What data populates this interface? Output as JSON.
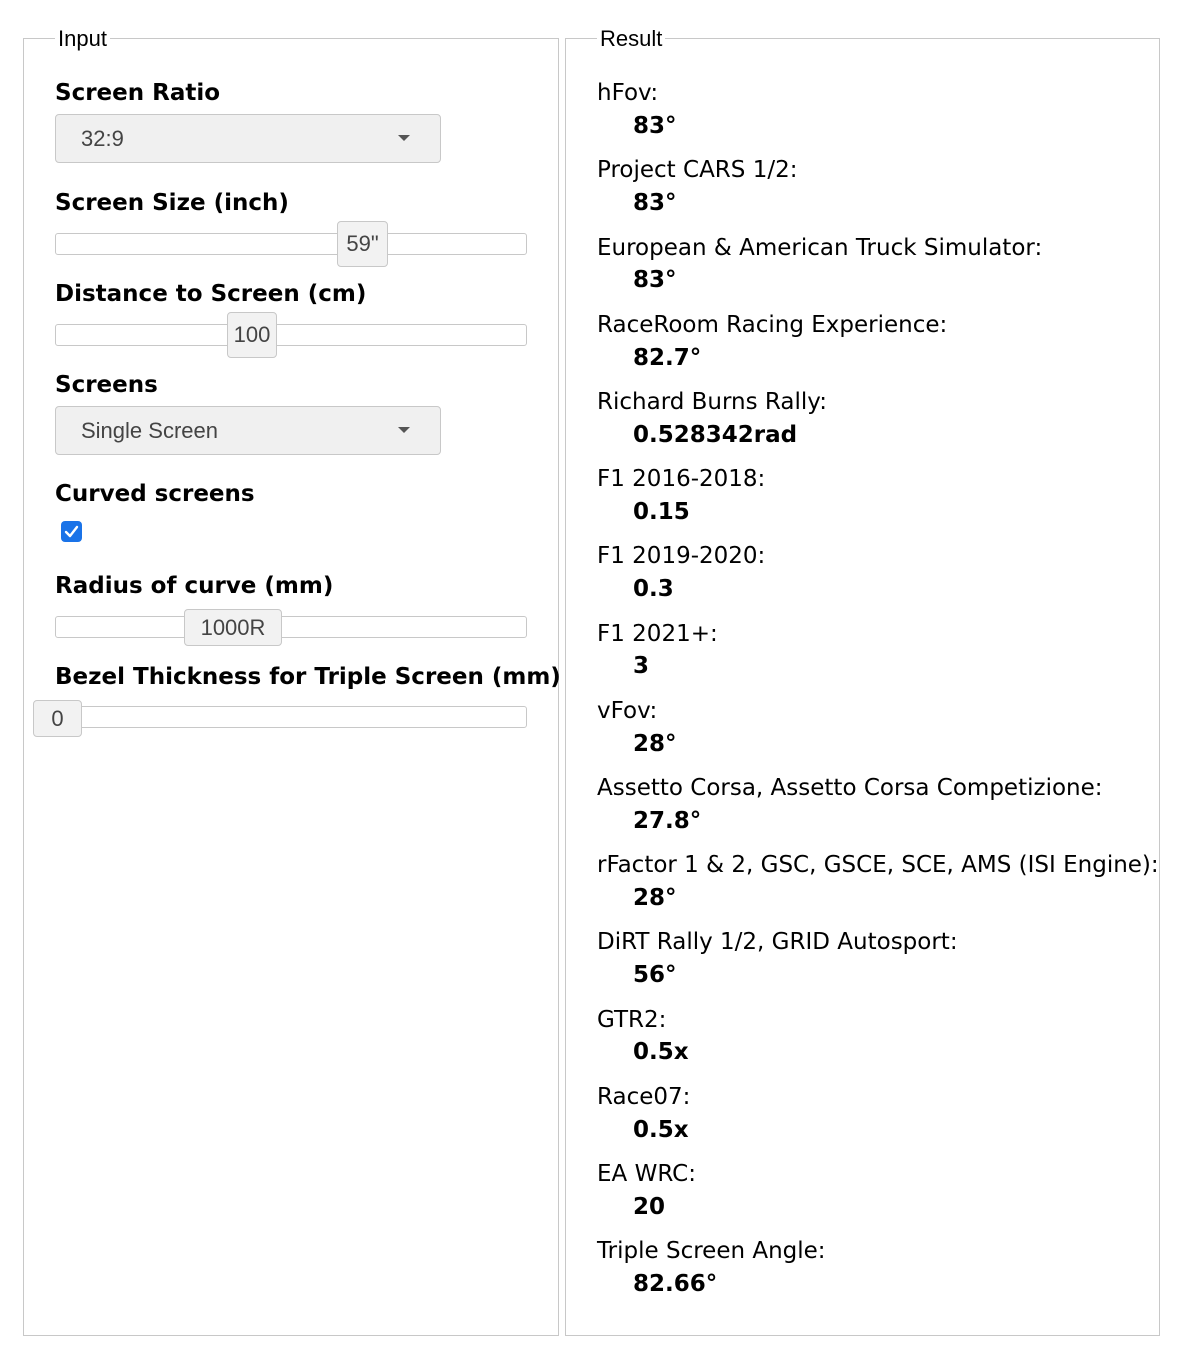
{
  "input": {
    "legend": "Input",
    "screen_ratio": {
      "label": "Screen Ratio",
      "value": "32:9"
    },
    "screen_size": {
      "label": "Screen Size (inch)",
      "value": "59\""
    },
    "distance": {
      "label": "Distance to Screen (cm)",
      "value": "100"
    },
    "screens": {
      "label": "Screens",
      "value": "Single Screen"
    },
    "curved": {
      "label": "Curved screens",
      "checked": true
    },
    "radius": {
      "label": "Radius of curve (mm)",
      "value": "1000R"
    },
    "bezel": {
      "label": "Bezel Thickness for Triple Screen (mm)",
      "value": "0"
    }
  },
  "result": {
    "legend": "Result",
    "items": [
      {
        "label": "hFov:",
        "value": "83°"
      },
      {
        "label": "Project CARS 1/2:",
        "value": "83°"
      },
      {
        "label": "European & American Truck Simulator:",
        "value": "83°"
      },
      {
        "label": "RaceRoom Racing Experience:",
        "value": "82.7°"
      },
      {
        "label": "Richard Burns Rally:",
        "value": "0.528342rad"
      },
      {
        "label": "F1 2016-2018:",
        "value": "0.15"
      },
      {
        "label": "F1 2019-2020:",
        "value": "0.3"
      },
      {
        "label": "F1 2021+:",
        "value": "3"
      },
      {
        "label": "vFov:",
        "value": "28°"
      },
      {
        "label": "Assetto Corsa, Assetto Corsa Competizione:",
        "value": "27.8°"
      },
      {
        "label": "rFactor 1 & 2, GSC, GSCE, SCE, AMS (ISI Engine):",
        "value": "28°"
      },
      {
        "label": "DiRT Rally 1/2, GRID Autosport:",
        "value": "56°"
      },
      {
        "label": "GTR2:",
        "value": "0.5x"
      },
      {
        "label": "Race07:",
        "value": "0.5x"
      },
      {
        "label": "EA WRC:",
        "value": "20"
      },
      {
        "label": "Triple Screen Angle:",
        "value": "82.66°"
      }
    ]
  }
}
